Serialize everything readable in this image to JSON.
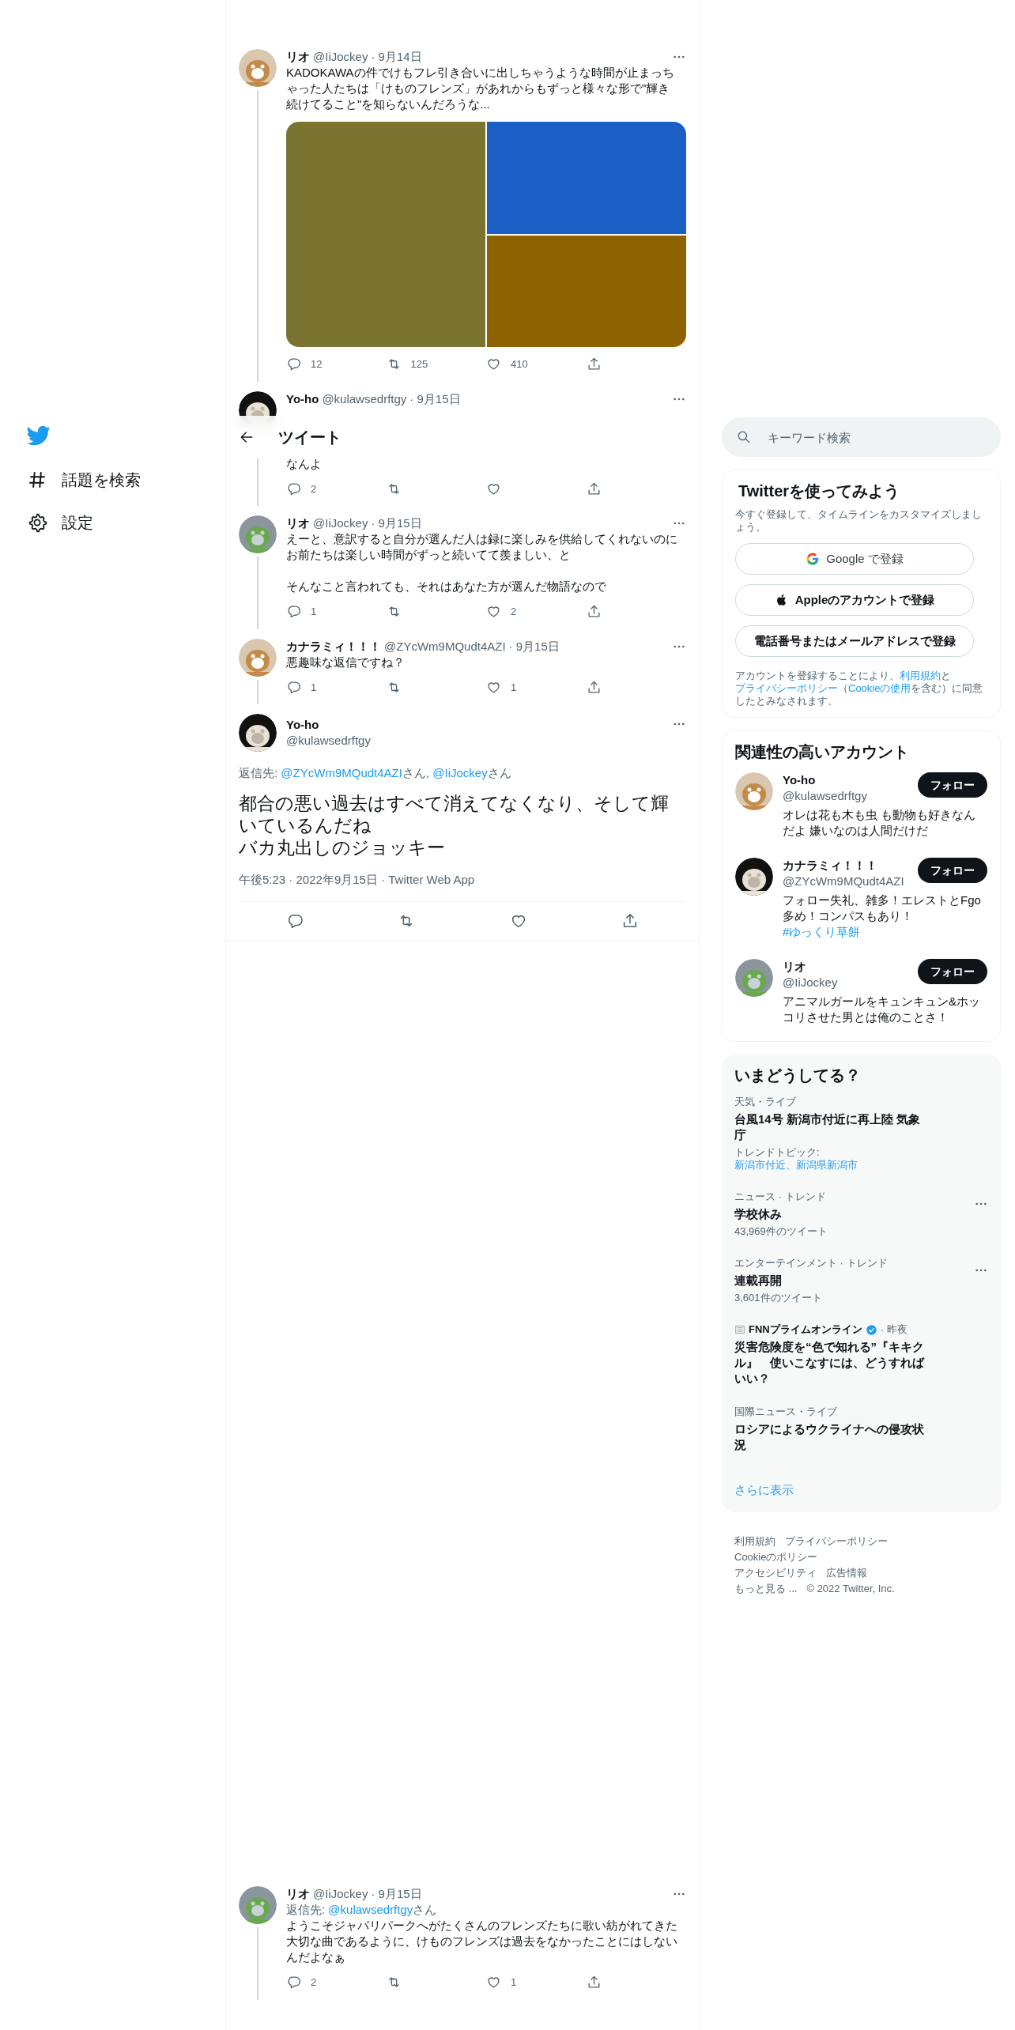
{
  "nav": {
    "items": [
      {
        "label": "話題を検索"
      },
      {
        "label": "設定"
      }
    ]
  },
  "header": {
    "title": "ツイート"
  },
  "thread": [
    {
      "kind": "normal",
      "name": "リオ",
      "handle": "@IiJockey",
      "date": "· 9月14日",
      "text": "KADOKAWAの件でけもフレ引き合いに出しちゃうような時間が止まっちゃった人たちは「けものフレンズ」があれからもずっと様々な形で\"輝き続けてること\"を知らないんだろうな...",
      "replies": "12",
      "retweets": "125",
      "likes": "410"
    },
    {
      "kind": "under_header",
      "name": "Yo-ho",
      "handle": "@kulawsedrftgy",
      "date": "· 9月15日",
      "text": "なんよ",
      "replies": "2"
    },
    {
      "kind": "normal",
      "name": "リオ",
      "handle": "@IiJockey",
      "date": "· 9月15日",
      "paragraphs": [
        "えーと、意訳すると自分が選んだ人は録に楽しみを供給してくれないのにお前たちは楽しい時間がずっと続いてて羨ましい、と",
        "そんなこと言われても、それはあなた方が選んだ物語なので"
      ],
      "replies": "1",
      "likes": "2"
    },
    {
      "kind": "normal",
      "name": "カナラミィ！！！",
      "handle": "@ZYcWm9MQudt4AZI",
      "date": "· 9月15日",
      "text": "悪趣味な返信ですね？",
      "replies": "1",
      "likes": "1"
    }
  ],
  "main_tweet": {
    "name": "Yo-ho",
    "handle": "@kulawsedrftgy",
    "reply_to": [
      {
        "text": "返信先: ",
        "link": false
      },
      {
        "text": "@ZYcWm9MQudt4AZI",
        "link": true
      },
      {
        "text": "さん, ",
        "link": false
      },
      {
        "text": "@IiJockey",
        "link": true
      },
      {
        "text": "さん",
        "link": false
      }
    ],
    "paragraphs": [
      "都合の悪い過去はすべて消えてなくなり、そして輝いているんだね",
      "バカ丸出しのジョッキー"
    ],
    "meta": "午後5:23 · 2022年9月15日 · Twitter Web App"
  },
  "replies": [
    {
      "kind": "normal",
      "name": "リオ",
      "handle": "@IiJockey",
      "date": "· 9月15日",
      "reply_to": [
        {
          "text": "返信先: ",
          "link": false
        },
        {
          "text": "@kulawsedrftgy",
          "link": true
        },
        {
          "text": "さん",
          "link": false
        }
      ],
      "text": "ようこそジャパリパークへがたくさんのフレンズたちに歌い紡がれてきた大切な曲であるように、けものフレンズは過去をなかったことにはしないんだよなぁ",
      "replies": "2",
      "likes": "1"
    }
  ],
  "search": {
    "placeholder": "キーワード検索"
  },
  "signup": {
    "title": "Twitterを使ってみよう",
    "subtitle": "今すぐ登録して、タイムラインをカスタマイズしましょう。",
    "buttons": [
      {
        "kind": "google",
        "label": "Google で登録"
      },
      {
        "kind": "apple",
        "label": "Appleのアカウントで登録"
      },
      {
        "kind": "plain",
        "label": "電話番号またはメールアドレスで登録"
      }
    ],
    "terms": [
      {
        "text": "アカウントを登録することにより、",
        "link": false
      },
      {
        "text": "利用規約",
        "link": true
      },
      {
        "text": "と",
        "link": false
      },
      {
        "text": "プライバシーポリシー",
        "link": true
      },
      {
        "text": "（",
        "link": false
      },
      {
        "text": "Cookieの使用",
        "link": true
      },
      {
        "text": "を含む）に同意したとみなされます。",
        "link": false
      }
    ]
  },
  "who_to_follow": {
    "title": "関連性の高いアカウント",
    "accounts": [
      {
        "name": "Yo-ho",
        "handle": "@kulawsedrftgy",
        "button": "フォロー",
        "bio": [
          {
            "text": "オレは花も木も虫 も動物も好きなんだよ 嫌いなのは人間だけだ",
            "link": false
          }
        ]
      },
      {
        "name": "カナラミィ！！！",
        "handle": "@ZYcWm9MQudt4AZI",
        "button": "フォロー",
        "bio": [
          {
            "text": "フォロー失礼、雑多！エレストとFgo多め！コンパスもあり！ ",
            "link": false
          },
          {
            "text": "#ゆっくり草餅",
            "link": true
          }
        ]
      },
      {
        "name": "リオ",
        "handle": "@IiJockey",
        "button": "フォロー",
        "bio": [
          {
            "text": "アニマルガールをキュンキュン&ホッコリさせた男とは俺のことさ！",
            "link": false
          }
        ]
      }
    ]
  },
  "trends": {
    "title": "いまどうしてる？",
    "items": [
      {
        "kind": "trend",
        "category": "天気・ライブ",
        "title": "台風14号 新潟市付近に再上陸 気象庁",
        "detail": [
          {
            "text": "トレンドトピック: ",
            "link": false
          },
          {
            "text": "新潟市付近、新潟県新潟市",
            "link": true
          }
        ],
        "menu": false
      },
      {
        "kind": "trend",
        "category": "ニュース · トレンド",
        "title": "学校休み",
        "detail": [
          {
            "text": "43,969件のツイート",
            "link": false
          }
        ],
        "menu": true
      },
      {
        "kind": "trend",
        "category": "エンターテインメント · トレンド",
        "title": "連載再開",
        "detail": [
          {
            "text": "3,601件のツイート",
            "link": false
          }
        ],
        "menu": true
      },
      {
        "kind": "news",
        "source": "FNNプライムオンライン",
        "verified": true,
        "time": "· 昨夜",
        "title": "災害危険度を“色で知れる”『キキクル』　使いこなすには、どうすればいい？"
      },
      {
        "kind": "trend",
        "category": "国際ニュース・ライブ",
        "title": "ロシアによるウクライナへの侵攻状況",
        "menu": false
      }
    ],
    "more": "さらに表示"
  },
  "footer": {
    "links": [
      "利用規約",
      "プライバシーポリシー",
      "Cookieのポリシー",
      "アクセシビリティ",
      "広告情報",
      "もっと見る ..."
    ],
    "copyright": "© 2022 Twitter, Inc."
  }
}
